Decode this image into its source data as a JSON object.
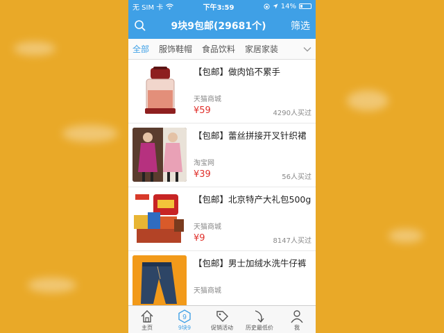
{
  "status_bar": {
    "carrier": "无 SIM 卡",
    "time": "下午3:59",
    "battery": "14%"
  },
  "nav": {
    "title": "9块9包邮(29681个)",
    "filter_label": "筛选",
    "search_icon": "search-icon"
  },
  "tabs": [
    "全部",
    "服饰鞋帽",
    "食品饮料",
    "家居家装"
  ],
  "products": [
    {
      "title": "【包邮】做肉馅不累手",
      "shop": "天猫商城",
      "price": "¥59",
      "sold": "4290人买过"
    },
    {
      "title": "【包邮】蕾丝拼接开叉针织裙",
      "shop": "淘宝网",
      "price": "¥39",
      "sold": "56人买过"
    },
    {
      "title": "【包邮】北京特产大礼包500g",
      "shop": "天猫商城",
      "price": "¥9",
      "sold": "8147人买过"
    },
    {
      "title": "【包邮】男士加绒水洗牛仔裤",
      "shop": "天猫商城",
      "price": "",
      "sold": ""
    }
  ],
  "tabbar": [
    {
      "label": "主页",
      "icon": "home-icon"
    },
    {
      "label": "9块9",
      "icon": "nine-badge-icon"
    },
    {
      "label": "促销活动",
      "icon": "tag-icon"
    },
    {
      "label": "历史最低价",
      "icon": "down-arrow-icon"
    },
    {
      "label": "我",
      "icon": "user-icon"
    }
  ],
  "colors": {
    "accent": "#3fa0e6",
    "price": "#e0312c",
    "background": "#e9a928"
  }
}
